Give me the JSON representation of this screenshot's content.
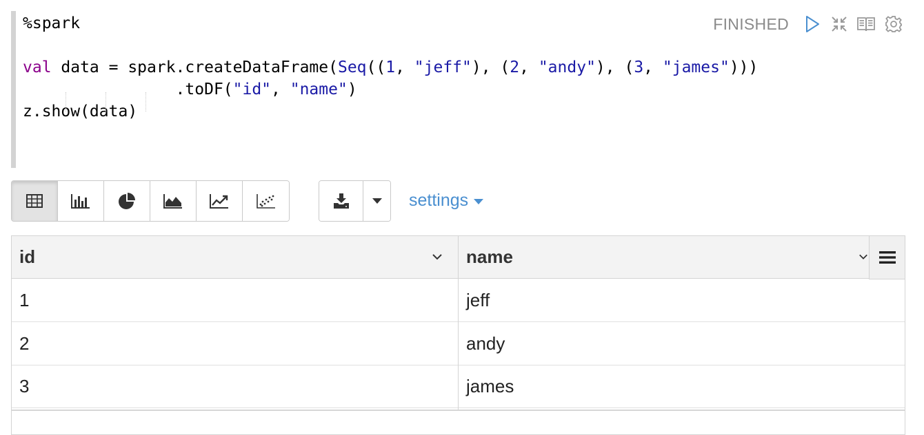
{
  "editor": {
    "interpreter": "%spark",
    "line2": {
      "kw": "val",
      "a": " data = spark.createDataFrame(",
      "cls": "Seq",
      "b": "((",
      "n1": "1",
      "c": ", ",
      "s1": "\"jeff\"",
      "d": "), (",
      "n2": "2",
      "e": ", ",
      "s2": "\"andy\"",
      "f": "), (",
      "n3": "3",
      "g": ", ",
      "s3": "\"james\"",
      "h": ")))"
    },
    "line3": {
      "a": "                .toDF(",
      "s1": "\"id\"",
      "b": ", ",
      "s2": "\"name\"",
      "c": ")"
    },
    "line4": "z.show(data)"
  },
  "paragraph": {
    "status": "FINISHED",
    "controls": [
      "play-icon",
      "collapse-icon",
      "book-icon",
      "gear-icon"
    ]
  },
  "toolbar": {
    "visualizations": [
      "table-icon",
      "bar-chart-icon",
      "pie-chart-icon",
      "area-chart-icon",
      "line-chart-icon",
      "scatter-chart-icon"
    ],
    "active": "table-icon",
    "download_icon": "download-icon",
    "settings_label": "settings"
  },
  "table": {
    "columns": [
      "id",
      "name"
    ],
    "rows": [
      [
        "1",
        "jeff"
      ],
      [
        "2",
        "andy"
      ],
      [
        "3",
        "james"
      ]
    ]
  },
  "colors": {
    "accent": "#4a8fd0",
    "keyword": "#8b008b",
    "literal": "#1a1aa6",
    "status": "#8a8a8a"
  }
}
